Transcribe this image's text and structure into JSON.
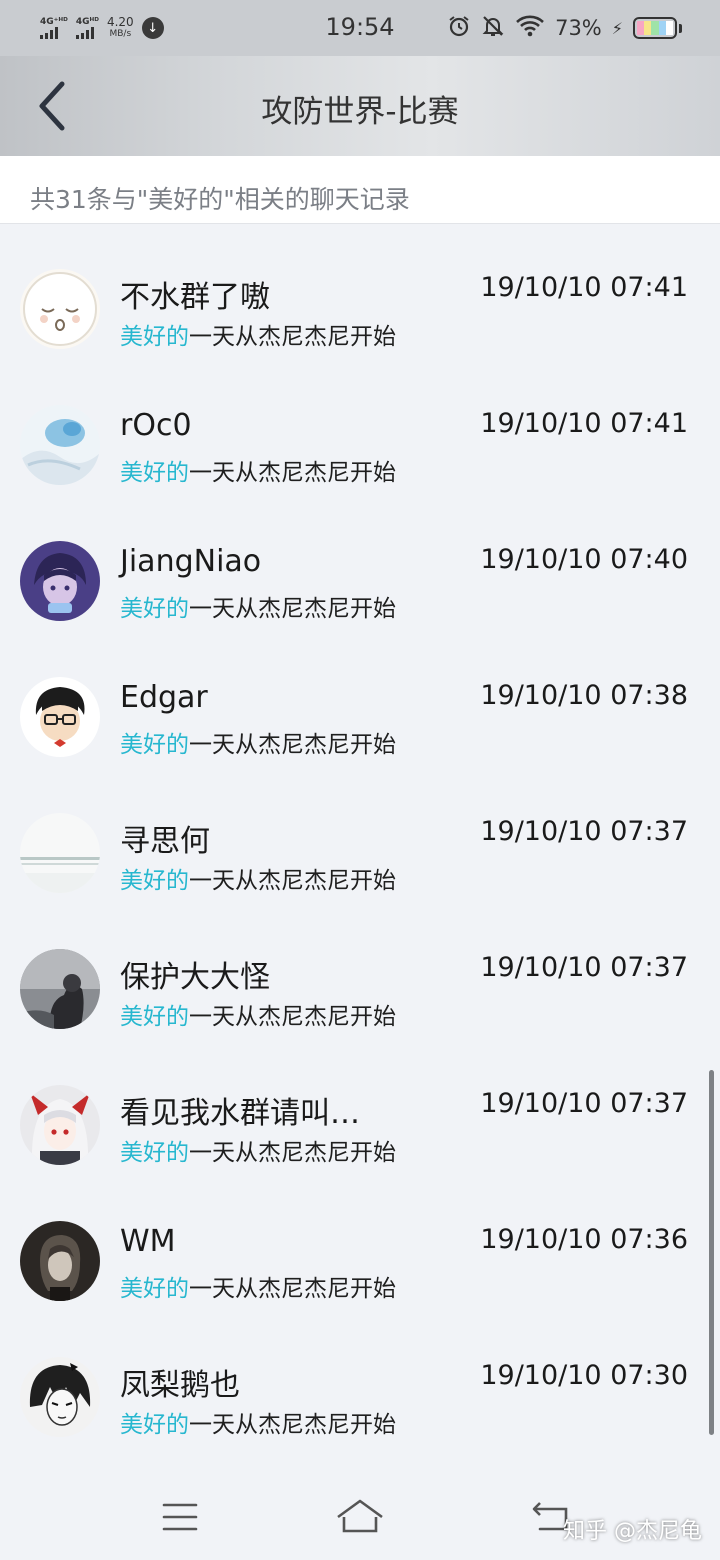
{
  "status_bar": {
    "sim1": "4G⁺ᴴᴰ",
    "sim2": "4Gᴴᴰ",
    "net_speed": "4.20",
    "net_speed_unit": "MB/s",
    "time": "19:54",
    "battery": "73%"
  },
  "header": {
    "title": "攻防世界-比赛"
  },
  "summary": "共31条与\"美好的\"相关的聊天记录",
  "colors": {
    "highlight": "#27b7cf",
    "background": "#f1f3f7"
  },
  "results": [
    {
      "name": "不水群了嗷",
      "time": "19/10/10 07:41",
      "highlight": "美好的",
      "rest": "一天从杰尼杰尼开始"
    },
    {
      "name": "rOc0",
      "time": "19/10/10 07:41",
      "highlight": "美好的",
      "rest": "一天从杰尼杰尼开始"
    },
    {
      "name": "JiangNiao",
      "time": "19/10/10 07:40",
      "highlight": "美好的",
      "rest": "一天从杰尼杰尼开始"
    },
    {
      "name": "Edgar",
      "time": "19/10/10 07:38",
      "highlight": "美好的",
      "rest": "一天从杰尼杰尼开始"
    },
    {
      "name": "寻思何",
      "time": "19/10/10 07:37",
      "highlight": "美好的",
      "rest": "一天从杰尼杰尼开始"
    },
    {
      "name": "保护大大怪",
      "time": "19/10/10 07:37",
      "highlight": "美好的",
      "rest": "一天从杰尼杰尼开始"
    },
    {
      "name": "看见我水群请叫…",
      "time": "19/10/10 07:37",
      "highlight": "美好的",
      "rest": "一天从杰尼杰尼开始"
    },
    {
      "name": "WM",
      "time": "19/10/10 07:36",
      "highlight": "美好的",
      "rest": "一天从杰尼杰尼开始"
    },
    {
      "name": "凤梨鹅也",
      "time": "19/10/10 07:30",
      "highlight": "美好的",
      "rest": "一天从杰尼杰尼开始"
    }
  ],
  "watermark": "知乎 @杰尼龟"
}
